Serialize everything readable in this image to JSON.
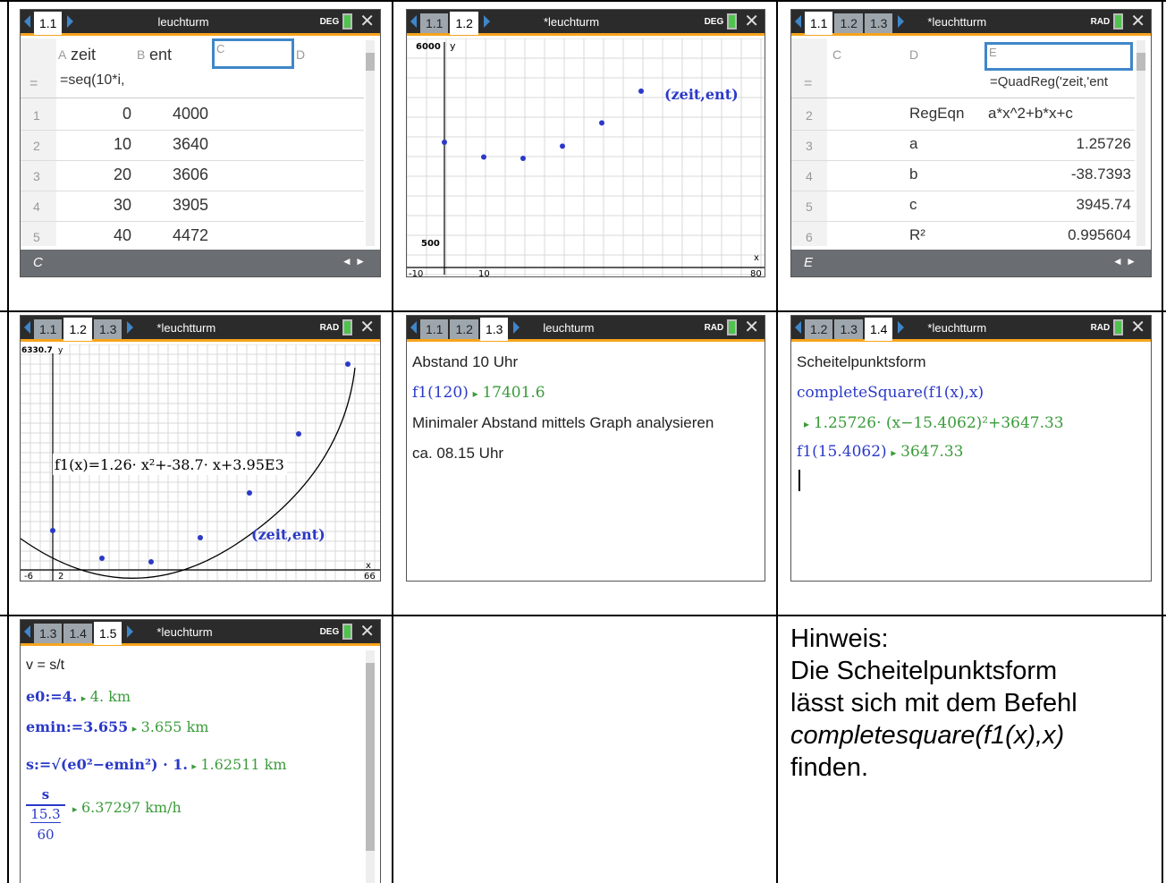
{
  "panels": {
    "p1": {
      "tabs": [
        "1.1"
      ],
      "doc": "leuchturm",
      "mode": "DEG",
      "col_a_label": "A",
      "col_a_name": "zeit",
      "col_b_label": "B",
      "col_b_name": "ent",
      "col_c_label": "C",
      "col_d_label": "D",
      "formula": "=seq(10*i,",
      "rows": [
        {
          "n": "1",
          "a": "0",
          "b": "4000"
        },
        {
          "n": "2",
          "a": "10",
          "b": "3640"
        },
        {
          "n": "3",
          "a": "20",
          "b": "3606"
        },
        {
          "n": "4",
          "a": "30",
          "b": "3905"
        },
        {
          "n": "5",
          "a": "40",
          "b": "4472"
        }
      ],
      "footer": "C",
      "nav": "◄ ►"
    },
    "p2": {
      "tabs": [
        "1.1",
        "1.2"
      ],
      "doc": "*leuchturm",
      "mode": "DEG",
      "ymax": "6000",
      "yaxis": "y",
      "ymin": "500",
      "xmin": "-10",
      "xtick": "10",
      "xmax": "80",
      "xaxis": "x",
      "label": "(zeit,ent)"
    },
    "p3": {
      "tabs": [
        "1.1",
        "1.2",
        "1.3"
      ],
      "doc": "*leuchtturm",
      "mode": "RAD",
      "col_c": "C",
      "col_d": "D",
      "col_e": "E",
      "formula": "=QuadReg('zeit,'ent",
      "rows": [
        {
          "n": "2",
          "d": "RegEqn",
          "e": "a*x^2+b*x+c"
        },
        {
          "n": "3",
          "d": "a",
          "e": "1.25726"
        },
        {
          "n": "4",
          "d": "b",
          "e": "-38.7393"
        },
        {
          "n": "5",
          "d": "c",
          "e": "3945.74"
        },
        {
          "n": "6",
          "d": "R²",
          "e": "0.995604"
        }
      ],
      "footer": "E",
      "nav": "◄ ►"
    },
    "p4": {
      "tabs": [
        "1.1",
        "1.2",
        "1.3"
      ],
      "doc": "*leuchtturm",
      "mode": "RAD",
      "ymax": "6330.7",
      "yaxis": "y",
      "xmin": "-6",
      "xtick": "2",
      "xmax": "66",
      "xaxis": "x",
      "fn": "f1(x)=1.26· x²+-38.7· x+3.95E3",
      "label": "(zeit,ent)"
    },
    "p5": {
      "tabs": [
        "1.1",
        "1.2",
        "1.3"
      ],
      "doc": "leuchturm",
      "mode": "RAD",
      "l1": "Abstand 10 Uhr",
      "l2a": "f1(120)",
      "l2b": "17401.6",
      "l3": "Minimaler Abstand mittels Graph analysieren",
      "l4": "ca. 08.15 Uhr"
    },
    "p6": {
      "tabs": [
        "1.2",
        "1.3",
        "1.4"
      ],
      "doc": "*leuchtturm",
      "mode": "RAD",
      "l1": "Scheitelpunktsform",
      "l2": "completeSquare(f1(x),x)",
      "l3": "1.25726· (x−15.4062)²+3647.33",
      "l4a": "f1(15.4062)",
      "l4b": "3647.33"
    },
    "p7": {
      "tabs": [
        "1.3",
        "1.4",
        "1.5"
      ],
      "doc": "*leuchturm",
      "mode": "DEG",
      "l1": "v = s/t",
      "l2a": "e0:=4.",
      "l2b": "4. km",
      "l3a": "emin:=3.655",
      "l3b": "3.655 km",
      "l4a": "s:=√(e0²−emin²) · 1.",
      "l4b": "1.62511 km",
      "l5num": "s",
      "l5den1": "15.3",
      "l5den2": "60",
      "l5res": "6.37297 km/h"
    }
  },
  "hint": {
    "line1": "Hinweis:",
    "line2": "Die Scheitelpunktsform",
    "line3": "lässt sich mit dem Befehl",
    "line4": "completesquare(f1(x),x)",
    "line5": "finden."
  },
  "colors": {
    "accent": "#f7a41d",
    "blue": "#2a39c8",
    "green": "#3a9b3a",
    "topbar": "#2b2b2b"
  }
}
